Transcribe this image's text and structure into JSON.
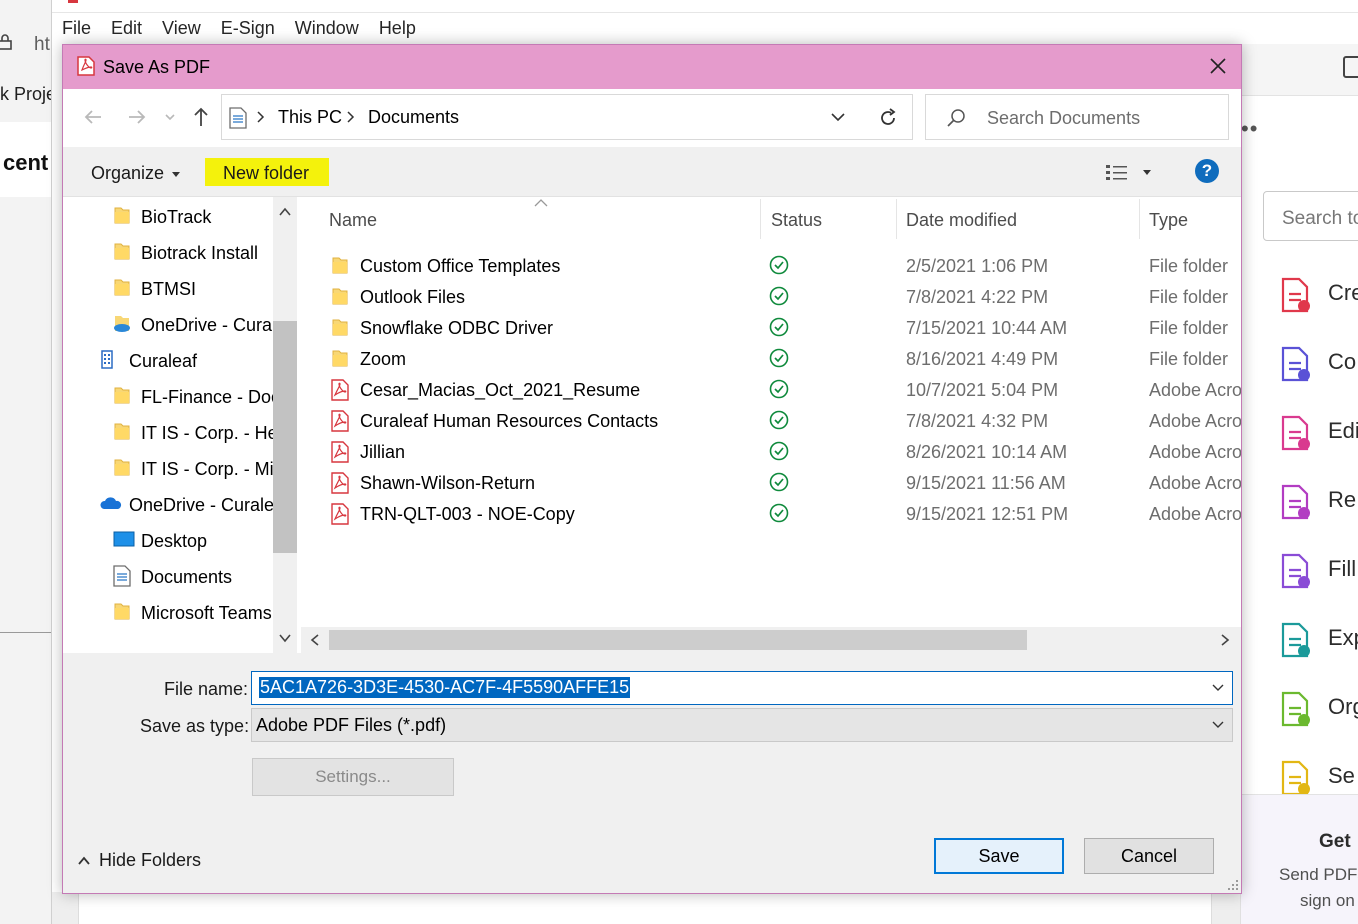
{
  "background": {
    "url_fragment": "ht",
    "tab_fragment": "k Proje",
    "heading_fragment": "cent",
    "menu": [
      "File",
      "Edit",
      "View",
      "E-Sign",
      "Window",
      "Help"
    ],
    "right_panel": {
      "search_placeholder": "Search to",
      "tools": [
        {
          "label": "Cre",
          "icon": "create-pdf-icon",
          "color": "#e0384b"
        },
        {
          "label": "Co",
          "icon": "combine-files-icon",
          "color": "#5a52d6"
        },
        {
          "label": "Edi",
          "icon": "edit-pdf-icon",
          "color": "#d93a8f"
        },
        {
          "label": "Re",
          "icon": "redact-icon",
          "color": "#b23cc2"
        },
        {
          "label": "Fill",
          "icon": "fill-sign-icon",
          "color": "#8a4cd6"
        },
        {
          "label": "Exp",
          "icon": "export-pdf-icon",
          "color": "#1b9a9a"
        },
        {
          "label": "Org",
          "icon": "organize-pages-icon",
          "color": "#6bb92f"
        },
        {
          "label": "Se",
          "icon": "send-comments-icon",
          "color": "#e2b714"
        }
      ],
      "promo_title": "Get",
      "promo_line1": "Send PDFs",
      "promo_line2": "sign on"
    }
  },
  "dialog": {
    "title": "Save As PDF",
    "title_color": "#e59bcc",
    "breadcrumb": [
      "This PC",
      "Documents"
    ],
    "search_placeholder": "Search Documents",
    "organize_label": "Organize",
    "new_folder_label": "New folder",
    "highlight_color": "#f4f20c",
    "help_label": "?",
    "nav_items": [
      {
        "label": "BioTrack",
        "icon": "folder-icon",
        "indent": 1
      },
      {
        "label": "Biotrack Install",
        "icon": "folder-icon",
        "indent": 1
      },
      {
        "label": "BTMSI",
        "icon": "folder-icon",
        "indent": 1
      },
      {
        "label": "OneDrive - Cural",
        "icon": "onedrive-folder-icon",
        "indent": 1
      },
      {
        "label": "Curaleaf",
        "icon": "building-icon",
        "indent": 0
      },
      {
        "label": "FL-Finance - Doc",
        "icon": "folder-icon",
        "indent": 1
      },
      {
        "label": "IT IS - Corp. - He",
        "icon": "folder-icon",
        "indent": 1
      },
      {
        "label": "IT IS - Corp. - Mi",
        "icon": "folder-icon",
        "indent": 1
      },
      {
        "label": "OneDrive - Curalea",
        "icon": "onedrive-cloud-icon",
        "indent": 0
      },
      {
        "label": "Desktop",
        "icon": "desktop-icon",
        "indent": 1
      },
      {
        "label": "Documents",
        "icon": "documents-icon",
        "indent": 1
      },
      {
        "label": "Microsoft Teams",
        "icon": "folder-icon",
        "indent": 1
      }
    ],
    "columns": [
      "Name",
      "Status",
      "Date modified",
      "Type"
    ],
    "files": [
      {
        "name": "Custom Office Templates",
        "icon": "folder-icon",
        "status": "synced",
        "date": "2/5/2021 1:06 PM",
        "type": "File folder"
      },
      {
        "name": "Outlook Files",
        "icon": "folder-icon",
        "status": "synced",
        "date": "7/8/2021 4:22 PM",
        "type": "File folder"
      },
      {
        "name": "Snowflake ODBC Driver",
        "icon": "folder-icon",
        "status": "synced",
        "date": "7/15/2021 10:44 AM",
        "type": "File folder"
      },
      {
        "name": "Zoom",
        "icon": "folder-icon",
        "status": "synced",
        "date": "8/16/2021 4:49 PM",
        "type": "File folder"
      },
      {
        "name": "Cesar_Macias_Oct_2021_Resume",
        "icon": "pdf-file-icon",
        "status": "synced",
        "date": "10/7/2021 5:04 PM",
        "type": "Adobe Acro"
      },
      {
        "name": "Curaleaf Human Resources Contacts",
        "icon": "pdf-file-icon",
        "status": "synced",
        "date": "7/8/2021 4:32 PM",
        "type": "Adobe Acro"
      },
      {
        "name": "Jillian",
        "icon": "pdf-file-icon",
        "status": "synced",
        "date": "8/26/2021 10:14 AM",
        "type": "Adobe Acro"
      },
      {
        "name": "Shawn-Wilson-Return",
        "icon": "pdf-file-icon",
        "status": "synced",
        "date": "9/15/2021 11:56 AM",
        "type": "Adobe Acro"
      },
      {
        "name": "TRN-QLT-003 - NOE-Copy",
        "icon": "pdf-file-icon",
        "status": "synced",
        "date": "9/15/2021 12:51 PM",
        "type": "Adobe Acro"
      }
    ],
    "file_name_label": "File name:",
    "file_name_value": "5AC1A726-3D3E-4530-AC7F-4F5590AFFE15",
    "save_type_label": "Save as type:",
    "save_type_value": "Adobe PDF Files (*.pdf)",
    "settings_label": "Settings...",
    "hide_folders_label": "Hide Folders",
    "save_label": "Save",
    "cancel_label": "Cancel"
  }
}
